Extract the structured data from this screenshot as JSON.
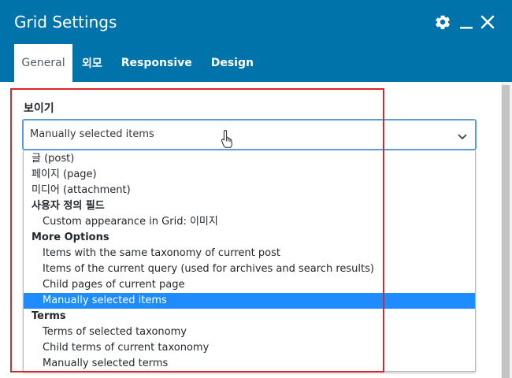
{
  "window": {
    "title": "Grid Settings",
    "icons": {
      "settings": "gear-icon",
      "minimize": "minimize-icon",
      "close": "close-icon"
    }
  },
  "tabs": [
    {
      "label": "General",
      "active": true
    },
    {
      "label": "외모",
      "active": false
    },
    {
      "label": "Responsive",
      "active": false
    },
    {
      "label": "Design",
      "active": false
    }
  ],
  "field": {
    "label": "보이기",
    "value": "Manually selected items"
  },
  "dropdown": {
    "items": [
      {
        "type": "option",
        "level": 0,
        "label": "글 (post)"
      },
      {
        "type": "option",
        "level": 0,
        "label": "페이지 (page)"
      },
      {
        "type": "option",
        "level": 0,
        "label": "미디어 (attachment)"
      },
      {
        "type": "group",
        "label": "사용자 정의 필드"
      },
      {
        "type": "option",
        "level": 1,
        "label": "Custom appearance in Grid: 이미지"
      },
      {
        "type": "group",
        "label": "More Options"
      },
      {
        "type": "option",
        "level": 1,
        "label": "Items with the same taxonomy of current post"
      },
      {
        "type": "option",
        "level": 1,
        "label": "Items of the current query (used for archives and search results)"
      },
      {
        "type": "option",
        "level": 1,
        "label": "Child pages of current page"
      },
      {
        "type": "option",
        "level": 1,
        "label": "Manually selected items",
        "selected": true
      },
      {
        "type": "group",
        "label": "Terms"
      },
      {
        "type": "option",
        "level": 1,
        "label": "Terms of selected taxonomy"
      },
      {
        "type": "option",
        "level": 1,
        "label": "Child terms of current taxonomy"
      },
      {
        "type": "option",
        "level": 1,
        "label": "Manually selected terms"
      }
    ]
  },
  "colors": {
    "header": "#0073aa",
    "selected_option": "#1e8cff",
    "annotation_box": "#e0232b"
  }
}
